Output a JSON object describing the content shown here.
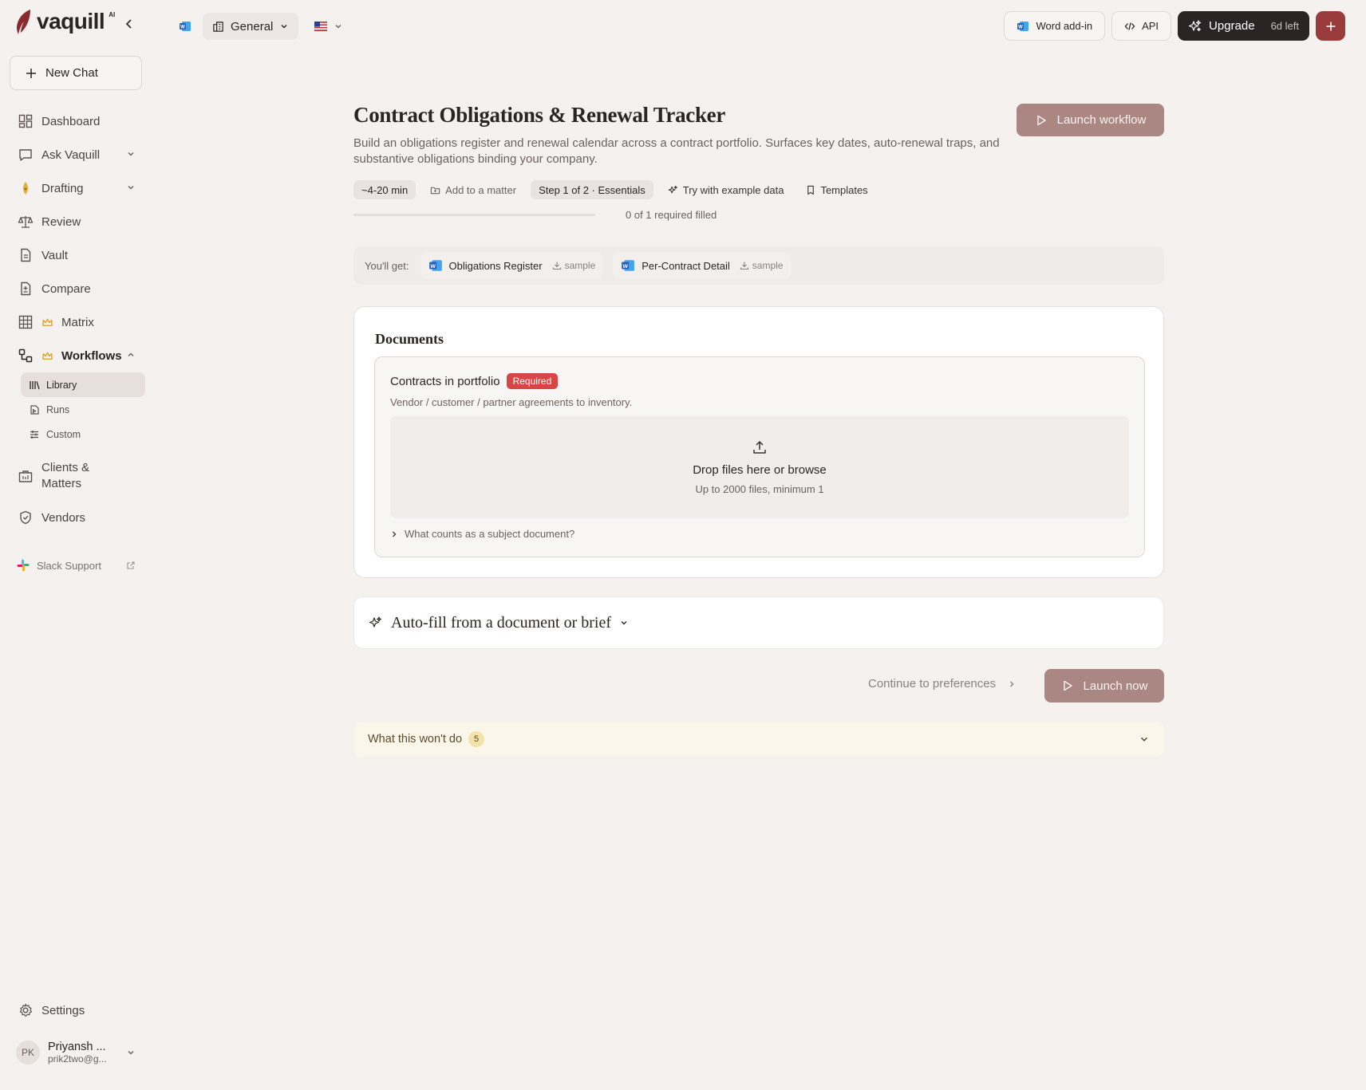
{
  "brand": {
    "name": "vaquill",
    "suffix": "AI"
  },
  "sidebar": {
    "new_chat": "New Chat",
    "items": [
      {
        "label": "Dashboard",
        "icon": "dashboard-icon"
      },
      {
        "label": "Ask Vaquill",
        "icon": "chat-bubble-icon",
        "expandable": true
      },
      {
        "label": "Drafting",
        "icon": "pen-nib-icon",
        "expandable": true
      },
      {
        "label": "Review",
        "icon": "scales-icon"
      },
      {
        "label": "Vault",
        "icon": "document-icon"
      },
      {
        "label": "Compare",
        "icon": "compare-icon"
      },
      {
        "label": "Matrix",
        "icon": "grid-icon",
        "premium": true
      },
      {
        "label": "Workflows",
        "icon": "workflow-icon",
        "premium": true,
        "expanded": true
      }
    ],
    "workflow_sub": [
      {
        "label": "Library",
        "icon": "library-icon",
        "active": true
      },
      {
        "label": "Runs",
        "icon": "runs-icon"
      },
      {
        "label": "Custom",
        "icon": "sliders-icon"
      }
    ],
    "clients_line1": "Clients &",
    "clients_line2": "Matters",
    "vendors": "Vendors",
    "slack_support": "Slack Support",
    "settings": "Settings",
    "user": {
      "initials": "PK",
      "name": "Priyansh ...",
      "email": "prik2two@g..."
    }
  },
  "topbar": {
    "workspace": "General",
    "word_addin": "Word add-in",
    "api": "API",
    "upgrade": "Upgrade",
    "days_left": "6d left"
  },
  "workflow": {
    "title": "Contract Obligations & Renewal Tracker",
    "launch_button": "Launch workflow",
    "description": "Build an obligations register and renewal calendar across a contract portfolio. Surfaces key dates, auto-renewal traps, and substantive obligations binding your company.",
    "duration": "~4-20 min",
    "add_to_matter": "Add to a matter",
    "step": "Step 1 of 2 · Essentials",
    "try_example": "Try with example data",
    "templates": "Templates",
    "progress_fraction": 0,
    "progress_text": "0 of 1 required filled"
  },
  "outputs": {
    "label": "You'll get:",
    "items": [
      {
        "name": "Obligations Register",
        "sample": "sample"
      },
      {
        "name": "Per-Contract Detail",
        "sample": "sample"
      }
    ]
  },
  "documents": {
    "title": "Documents",
    "field_label": "Contracts in portfolio",
    "required_badge": "Required",
    "field_help": "Vendor / customer / partner agreements to inventory.",
    "drop_title": "Drop files here or browse",
    "drop_sub": "Up to 2000 files, minimum 1",
    "subject_help": "What counts as a subject document?"
  },
  "autofill": {
    "label": "Auto-fill from a document or brief"
  },
  "actions": {
    "continue": "Continue to preferences",
    "launch_now": "Launch now"
  },
  "wont_do": {
    "label": "What this won't do",
    "count": "5"
  },
  "colors": {
    "background": "#f4f1ef",
    "accent_muted": "#aa8783",
    "upgrade_dark": "#2a2523",
    "plus_red": "#9b3c3c",
    "required_red": "#d94444",
    "premium_gold": "#d99e2b",
    "word_blue": "#2b5fb8"
  }
}
